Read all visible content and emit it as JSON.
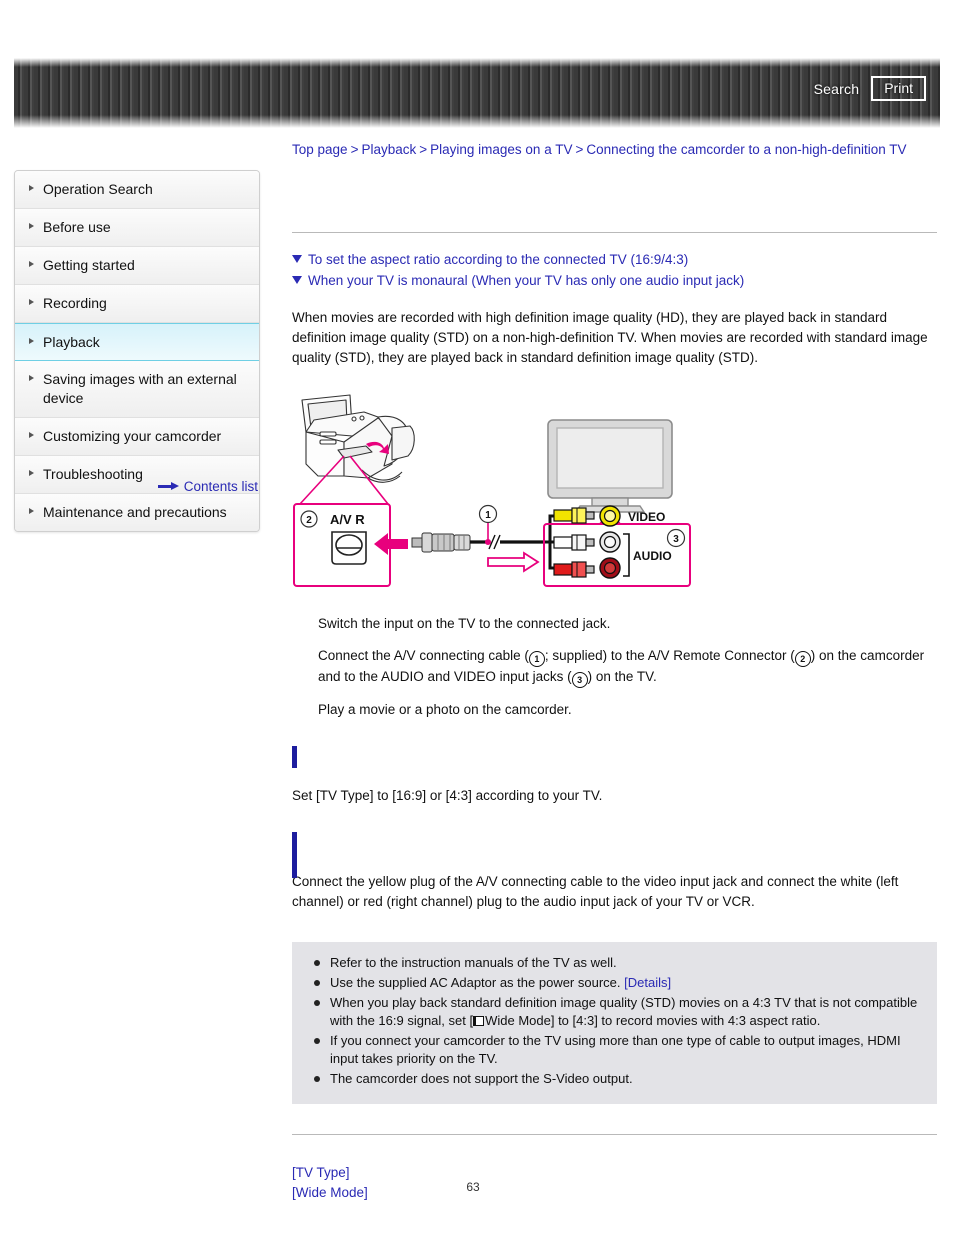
{
  "header": {
    "search_label": "Search",
    "print_label": "Print"
  },
  "breadcrumb": {
    "items": [
      "Top page",
      "Playback",
      "Playing images on a TV",
      "Connecting the camcorder to a non-high-definition TV"
    ],
    "separator": ">"
  },
  "sidebar": {
    "items": [
      {
        "label": "Operation Search",
        "active": false
      },
      {
        "label": "Before use",
        "active": false
      },
      {
        "label": "Getting started",
        "active": false
      },
      {
        "label": "Recording",
        "active": false
      },
      {
        "label": "Playback",
        "active": true
      },
      {
        "label": "Saving images with an external device",
        "active": false
      },
      {
        "label": "Customizing your camcorder",
        "active": false
      },
      {
        "label": "Troubleshooting",
        "active": false
      },
      {
        "label": "Maintenance and precautions",
        "active": false
      }
    ],
    "contents_list_label": "Contents list"
  },
  "main": {
    "jump_links": [
      "To set the aspect ratio according to the connected TV (16:9/4:3)",
      "When your TV is monaural (When your TV has only one audio input jack)"
    ],
    "intro": "When movies are recorded with high definition image quality (HD), they are played back in standard definition image quality (STD) on a non-high-definition TV. When movies are recorded with standard image quality (STD), they are played back in standard definition image quality (STD).",
    "steps": [
      "Switch the input on the TV to the connected jack.",
      "Play a movie or a photo on the camcorder."
    ],
    "step2": {
      "part1": "Connect the A/V connecting cable (",
      "num1": "1",
      "part2": "; supplied) to the A/V Remote Connector (",
      "num2": "2",
      "part3": ") on the camcorder and to the AUDIO and VIDEO input jacks (",
      "num3": "3",
      "part4": ") on the TV."
    },
    "sections": [
      {
        "heading": "",
        "body": "Set [TV Type] to [16:9] or [4:3] according to your TV."
      },
      {
        "heading": "",
        "body": "Connect the yellow plug of the A/V connecting cable to the video input jack and connect the white (left channel) or red (right channel) plug to the audio input jack of your TV or VCR."
      }
    ],
    "notes": [
      {
        "text": "Refer to the instruction manuals of the TV as well."
      },
      {
        "text": "Use the supplied AC Adaptor as the power source. ",
        "link": "[Details]"
      },
      {
        "text_before": "When you play back standard definition image quality (STD) movies on a 4:3 TV that is not compatible with the 16:9 signal, set [",
        "icon": "film-icon",
        "text_after": "Wide Mode] to [4:3] to record movies with 4:3 aspect ratio."
      },
      {
        "text": "If you connect your camcorder to the TV using more than one type of cable to output images, HDMI input takes priority on the TV."
      },
      {
        "text": "The camcorder does not support the S-Video output."
      }
    ],
    "related_links": [
      "[TV Type]",
      "[Wide Mode]"
    ]
  },
  "figure": {
    "callout_1": "1",
    "callout_2": "2",
    "callout_3": "3",
    "av_r_label": "A/V R",
    "video_label": "VIDEO",
    "audio_label": "AUDIO"
  },
  "page_number": "63",
  "colors": {
    "link": "#2a2ab4",
    "accent_magenta": "#e8007d",
    "section_bar": "#1d1d9e",
    "notes_bg": "#e3e3e7",
    "active_nav": "#d7f2fa"
  }
}
